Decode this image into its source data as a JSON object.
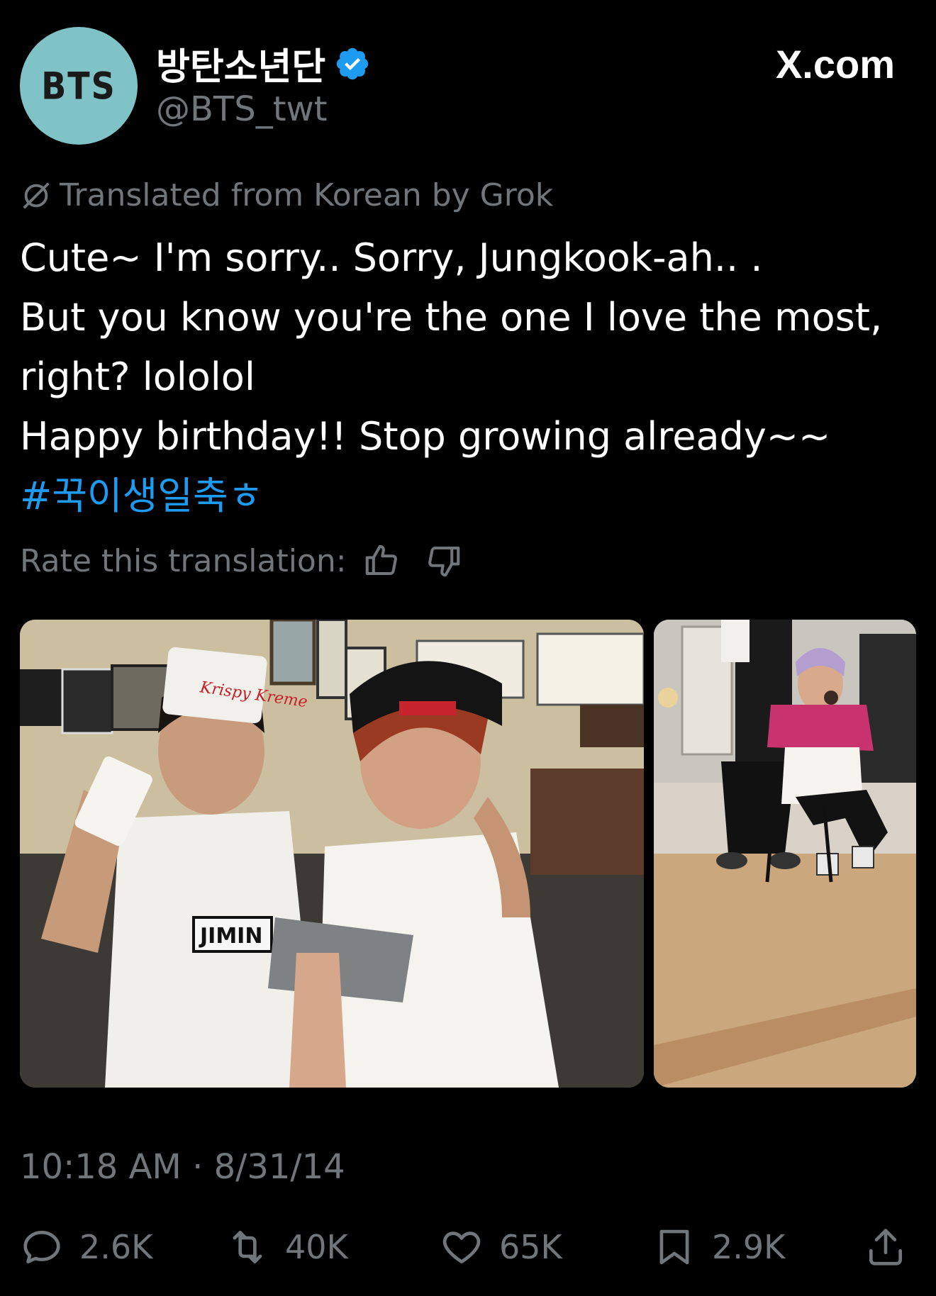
{
  "header": {
    "avatar_text": "BTS",
    "display_name": "방탄소년단",
    "handle": "@BTS_twt",
    "brand": "X.com",
    "verified": true
  },
  "translation": {
    "note": "Translated from Korean by Grok",
    "rate_label": "Rate this translation:"
  },
  "tweet": {
    "lines": [
      "Cute~ I'm sorry.. Sorry, Jungkook-ah.. .",
      "But you know you're the one I love the most,",
      "right? lololol",
      "Happy birthday!! Stop growing already~~"
    ],
    "hashtag": "#꾹이생일축ㅎ"
  },
  "media": {
    "left_shirt_label": "JIMIN",
    "hat_text": "Krispy Kreme"
  },
  "timestamp": "10:18 AM · 8/31/14",
  "actions": {
    "replies": "2.6K",
    "reposts": "40K",
    "likes": "65K",
    "bookmarks": "2.9K"
  },
  "colors": {
    "background": "#000000",
    "text": "#ffffff",
    "muted": "#71767b",
    "accent": "#1d9bf0",
    "avatar": "#7fc3c7"
  }
}
